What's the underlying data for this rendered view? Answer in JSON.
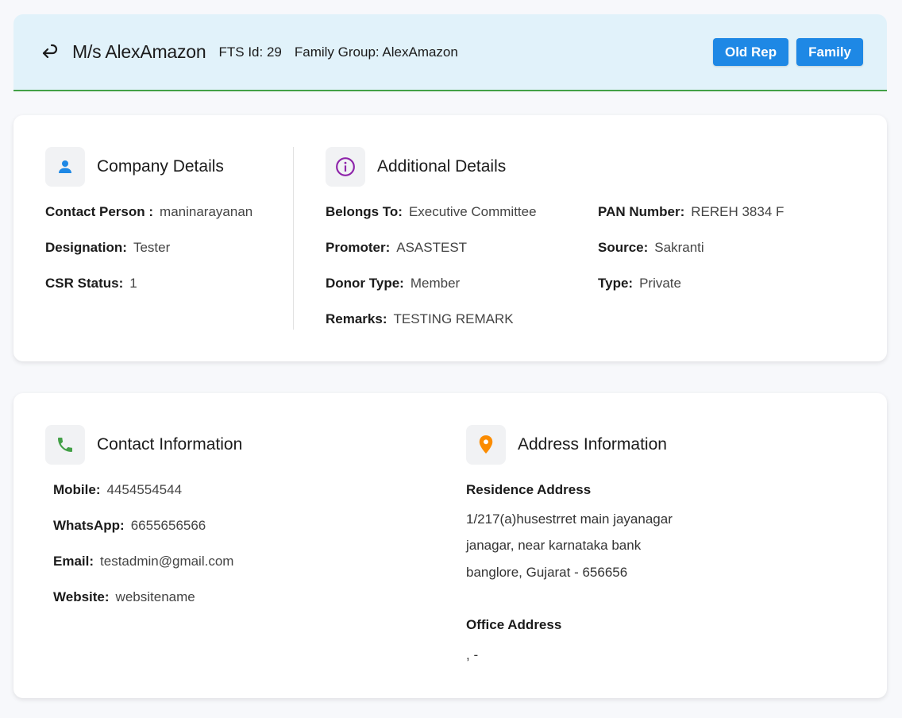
{
  "header": {
    "title": "M/s AlexAmazon",
    "fts_id": "FTS Id: 29",
    "family_group": "Family Group: AlexAmazon",
    "buttons": {
      "old_rep": "Old Rep",
      "family": "Family"
    }
  },
  "company": {
    "title": "Company Details",
    "fields": [
      {
        "label": "Contact Person :",
        "value": "maninarayanan"
      },
      {
        "label": "Designation:",
        "value": "Tester"
      },
      {
        "label": "CSR Status:",
        "value": "1"
      }
    ]
  },
  "additional": {
    "title": "Additional Details",
    "left": [
      {
        "label": "Belongs To:",
        "value": "Executive Committee"
      },
      {
        "label": "Promoter:",
        "value": "ASASTEST"
      },
      {
        "label": "Donor Type:",
        "value": "Member"
      },
      {
        "label": "Remarks:",
        "value": "TESTING REMARK"
      }
    ],
    "right": [
      {
        "label": "PAN Number:",
        "value": "REREH 3834 F"
      },
      {
        "label": "Source:",
        "value": "Sakranti"
      },
      {
        "label": "Type:",
        "value": "Private"
      }
    ]
  },
  "contact": {
    "title": "Contact Information",
    "fields": [
      {
        "label": "Mobile:",
        "value": "4454554544"
      },
      {
        "label": "WhatsApp:",
        "value": "6655656566"
      },
      {
        "label": "Email:",
        "value": "testadmin@gmail.com"
      },
      {
        "label": "Website:",
        "value": "websitename"
      }
    ]
  },
  "address": {
    "title": "Address Information",
    "residence_title": "Residence Address",
    "residence_lines": [
      "1/217(a)husestrret main jayanagar",
      "janagar, near karnataka bank",
      "banglore, Gujarat - 656656"
    ],
    "office_title": "Office Address",
    "office_line": ", -"
  },
  "colors": {
    "accent": "#1e88e5",
    "header_bg": "#e1f2fa",
    "header_border": "#43a047",
    "person_icon": "#1e88e5",
    "info_icon": "#8e24aa",
    "phone_icon": "#43a047",
    "pin_icon": "#fb8c00"
  },
  "icons": [
    "back-arrow-icon",
    "person-icon",
    "info-icon",
    "phone-icon",
    "location-pin-icon"
  ]
}
